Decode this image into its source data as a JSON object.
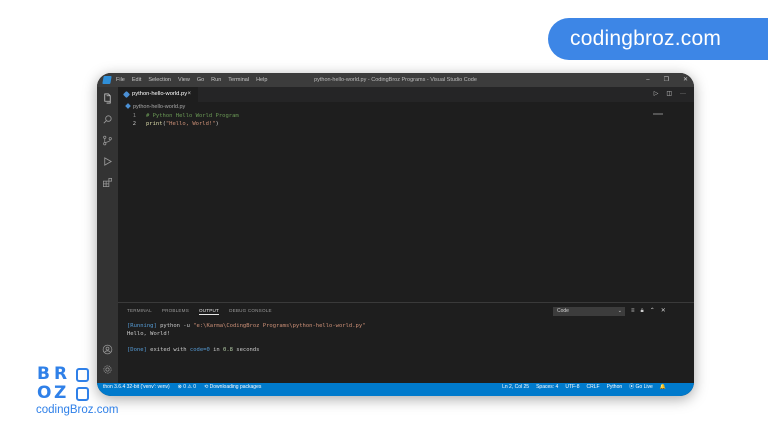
{
  "brand": {
    "pill_text": "codingbroz.com",
    "footer_url": "codingBroz.com",
    "logo_letters": [
      "B",
      "R",
      "O",
      "Z"
    ],
    "accent": "#3d86e6"
  },
  "window": {
    "title": "python-hello-world.py - CodingBroz Programs - Visual Studio Code",
    "menu": [
      "File",
      "Edit",
      "Selection",
      "View",
      "Go",
      "Run",
      "Terminal",
      "Help"
    ],
    "window_controls": [
      "minimize-icon",
      "restore-icon",
      "close-icon"
    ]
  },
  "activity_bar": {
    "icons": [
      "files-icon",
      "search-icon",
      "source-control-icon",
      "run-debug-icon",
      "extensions-icon",
      "account-icon",
      "settings-gear-icon"
    ]
  },
  "editor": {
    "tab": {
      "label": "python-hello-world.py",
      "close": "×"
    },
    "breadcrumb": "python-hello-world.py",
    "lines": [
      {
        "number": "1",
        "comment": "# Python Hello World Program"
      },
      {
        "number": "2",
        "fn": "print",
        "open": "(",
        "string": "\"Hello, World!\"",
        "close": ")"
      }
    ]
  },
  "panel": {
    "tabs": [
      "TERMINAL",
      "PROBLEMS",
      "OUTPUT",
      "DEBUG CONSOLE"
    ],
    "active_tab": "OUTPUT",
    "select_value": "Code",
    "output": {
      "line1_tag": "[Running]",
      "line1_cmd": " python -u ",
      "line1_path": "\"e:\\Karma\\CodingBroz Programs\\python-hello-world.py\"",
      "line2": "Hello, World!",
      "line3_tag": "[Done]",
      "line3_text": " exited with ",
      "line3_code": "code=0",
      "line3_in": " in ",
      "line3_secs": "0.8",
      "line3_end": " seconds"
    }
  },
  "status_bar": {
    "interpreter": "thon 3.6.4 32-bit ('venv': venv)",
    "problems": "⊗ 0 ⚠ 0",
    "downloading": "⟲ Downloading packages",
    "position": "Ln 2, Col 25",
    "spaces": "Spaces: 4",
    "encoding": "UTF-8",
    "eol": "CRLF",
    "language": "Python",
    "golive": "⦿ Go Live",
    "bell": "🔔"
  }
}
